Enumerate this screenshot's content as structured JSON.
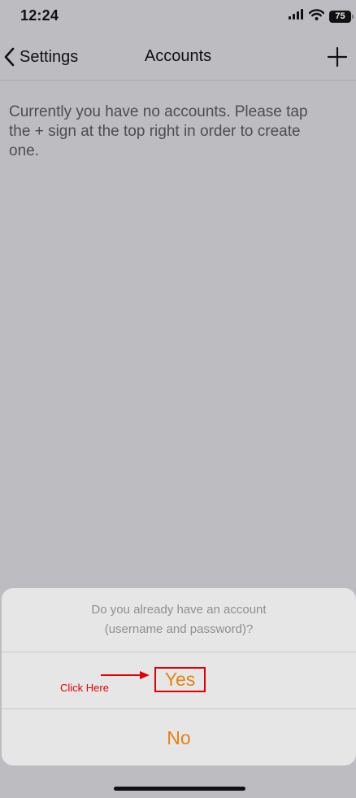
{
  "status_bar": {
    "time": "12:24",
    "battery": "75",
    "icons": [
      "signal-icon",
      "wifi-icon",
      "battery-icon"
    ]
  },
  "nav": {
    "back_label": "Settings",
    "title": "Accounts",
    "add_icon": "plus-icon",
    "back_icon": "chevron-left-icon"
  },
  "content": {
    "message": "Currently you have no accounts. Please tap the + sign at the top right in order to create one."
  },
  "action_sheet": {
    "message_line1": "Do you already have an account",
    "message_line2": "(username and password)?",
    "yes_label": "Yes",
    "no_label": "No"
  },
  "annotation": {
    "text": "Click Here",
    "color": "#e00000"
  },
  "colors": {
    "accent": "#e6820f",
    "background": "#bdbcc1",
    "sheet_background": "#e6e6e7"
  }
}
